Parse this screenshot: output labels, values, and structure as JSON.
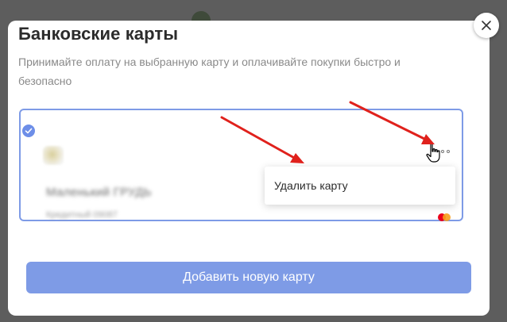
{
  "modal": {
    "title": "Банковские карты",
    "subtitle": "Принимайте оплату на выбранную карту и оплачивайте покупки быстро и безопасно",
    "add_button_label": "Добавить новую карту",
    "close_icon": "close-icon"
  },
  "card": {
    "selected": true,
    "check_icon": "check-icon",
    "bank_logo_icon": "bank-logo-icon",
    "card_holder": "Маленький ГРУДЬ",
    "card_number": "Кредитный 09087",
    "network_icon": "mastercard-icon",
    "menu_icon": "more-dots-icon"
  },
  "menu": {
    "items": [
      {
        "label": "Удалить карту"
      }
    ]
  },
  "annotations": {
    "arrow_color": "#e0211c",
    "cursor_icon": "hand-pointer-icon"
  },
  "colors": {
    "accent": "#7e9be6",
    "backdrop": "#5d5d5d"
  }
}
